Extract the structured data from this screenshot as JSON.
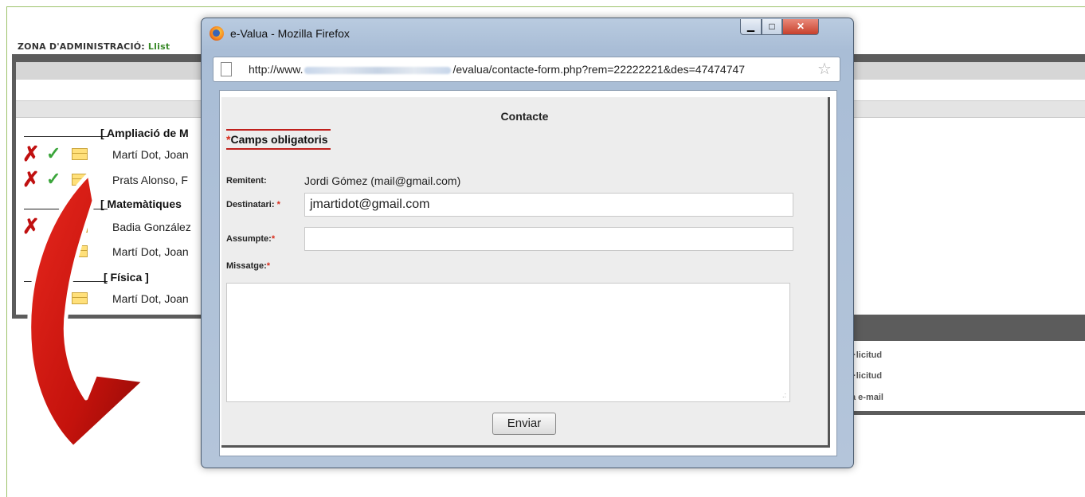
{
  "admin": {
    "zona_label": "ZONA D'ADMINISTRACIÓ:",
    "zona_link": "Llist",
    "groups": [
      {
        "title": "[ Ampliació de M"
      },
      {
        "title": "[ Matemàtiques"
      },
      {
        "title": "[ Física ]"
      }
    ],
    "rows": [
      {
        "name": "Martí Dot, Joan"
      },
      {
        "name": "Prats Alonso, F"
      },
      {
        "name": "Badia González"
      },
      {
        "name": "Martí Dot, Joan"
      },
      {
        "name": "Martí Dot, Joan"
      }
    ],
    "side_items": [
      "l·licitud",
      "l·licitud",
      "a e-mail"
    ]
  },
  "window": {
    "title": "e-Valua - Mozilla Firefox",
    "min_icon": "minimize-icon",
    "max_icon": "maximize-icon",
    "close_icon": "close-icon",
    "url_prefix": "http://www.",
    "url_suffix": "/evalua/contacte-form.php?rem=22222221&des=47474747"
  },
  "form": {
    "title": "Contacte",
    "required_note": "Camps obligatoris",
    "required_mark": "*",
    "remitent_label": "Remitent:",
    "remitent_value": "Jordi Gómez (mail@gmail.com)",
    "destinatari_label": "Destinatari:",
    "destinatari_value": "jmartidot@gmail.com",
    "assumpte_label": "Assumpte:",
    "assumpte_value": "",
    "missatge_label": "Missatge:",
    "missatge_value": "",
    "send_label": "Enviar"
  },
  "colors": {
    "accent_red": "#d92b1a",
    "frame_green": "#9cc36a"
  }
}
